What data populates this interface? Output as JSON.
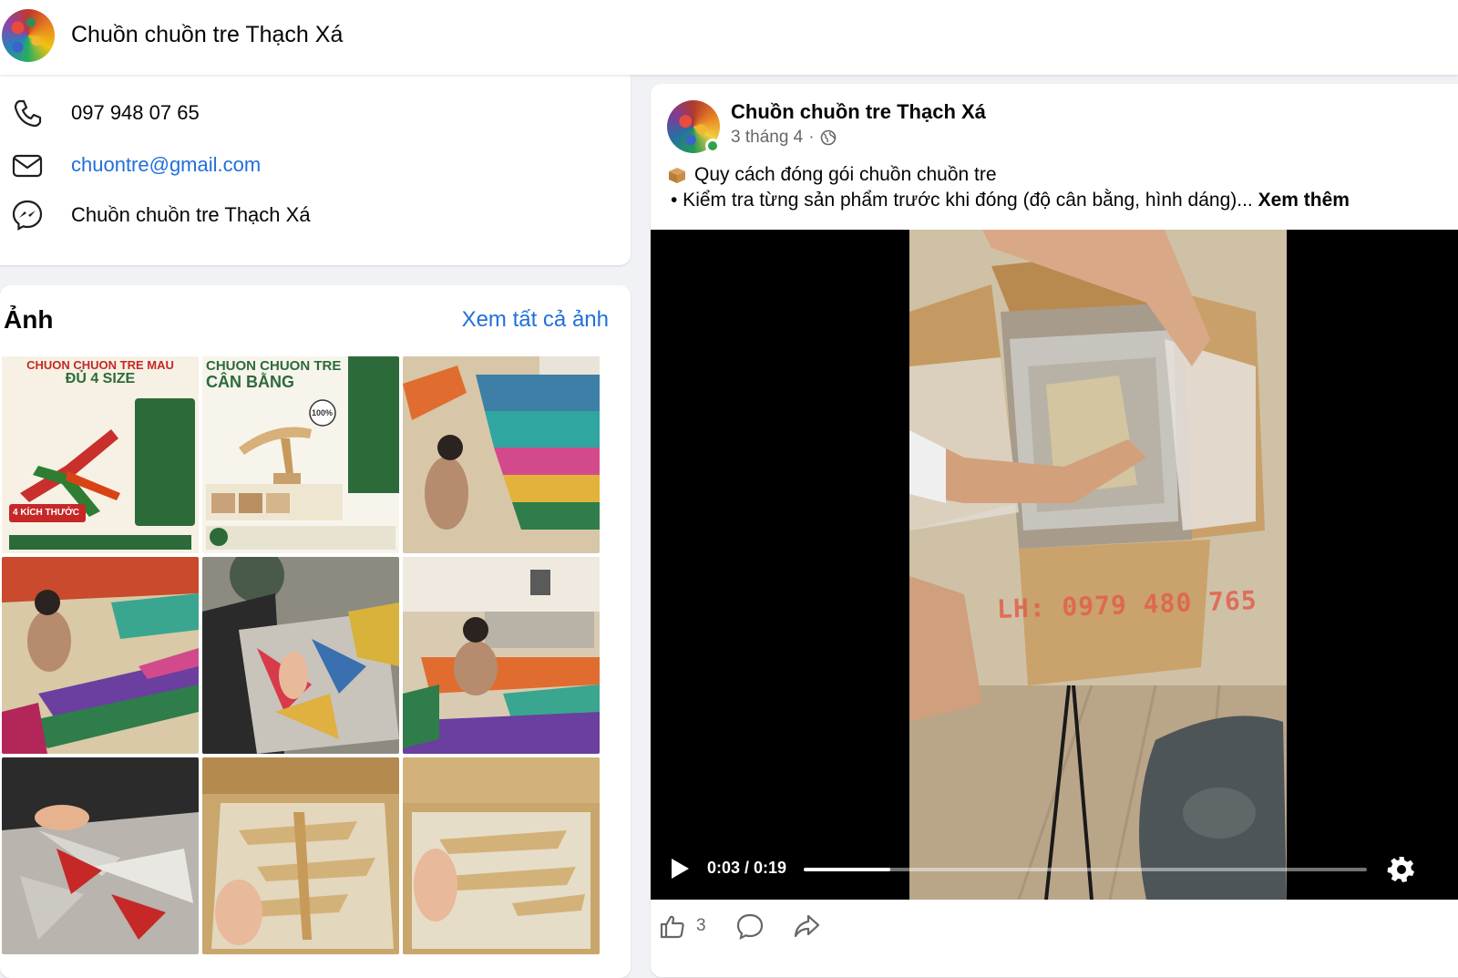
{
  "header": {
    "page_name": "Chuồn chuồn tre Thạch Xá"
  },
  "contact": {
    "phone": "097 948 07 65",
    "email": "chuontre@gmail.com",
    "messenger": "Chuồn chuồn tre Thạch Xá"
  },
  "photos": {
    "title": "Ảnh",
    "see_all": "Xem tất cả ảnh",
    "tiles": [
      {
        "headline": "CHUON CHUON TRE MAU",
        "sub": "ĐỦ 4 SIZE",
        "badge": "4 KÍCH THƯỚC"
      },
      {
        "headline": "CHUON CHUON TRE",
        "sub": "CÂN BẰNG",
        "badge": "100%"
      },
      {
        "headline": "",
        "sub": "",
        "badge": ""
      },
      {
        "headline": "",
        "sub": "",
        "badge": ""
      },
      {
        "headline": "",
        "sub": "",
        "badge": ""
      },
      {
        "headline": "",
        "sub": "",
        "badge": ""
      },
      {
        "headline": "",
        "sub": "",
        "badge": ""
      },
      {
        "headline": "",
        "sub": "",
        "badge": ""
      },
      {
        "headline": "",
        "sub": "",
        "badge": ""
      }
    ]
  },
  "post": {
    "author": "Chuồn chuồn tre Thạch Xá",
    "time": "3 tháng 4",
    "separator": "·",
    "line1": "Quy cách đóng gói chuồn chuồn tre",
    "line2": "• Kiểm tra từng sản phẩm trước khi đóng (độ cân bằng, hình dáng)...",
    "see_more": "Xem thêm",
    "video": {
      "time": "0:03 / 0:19",
      "progress": 0.154,
      "watermark": "LH: 0979 480 765"
    },
    "likes": "3"
  },
  "colors": {
    "link": "#216fdb",
    "online": "#31a24c",
    "page_bg": "#f0f2f5"
  }
}
